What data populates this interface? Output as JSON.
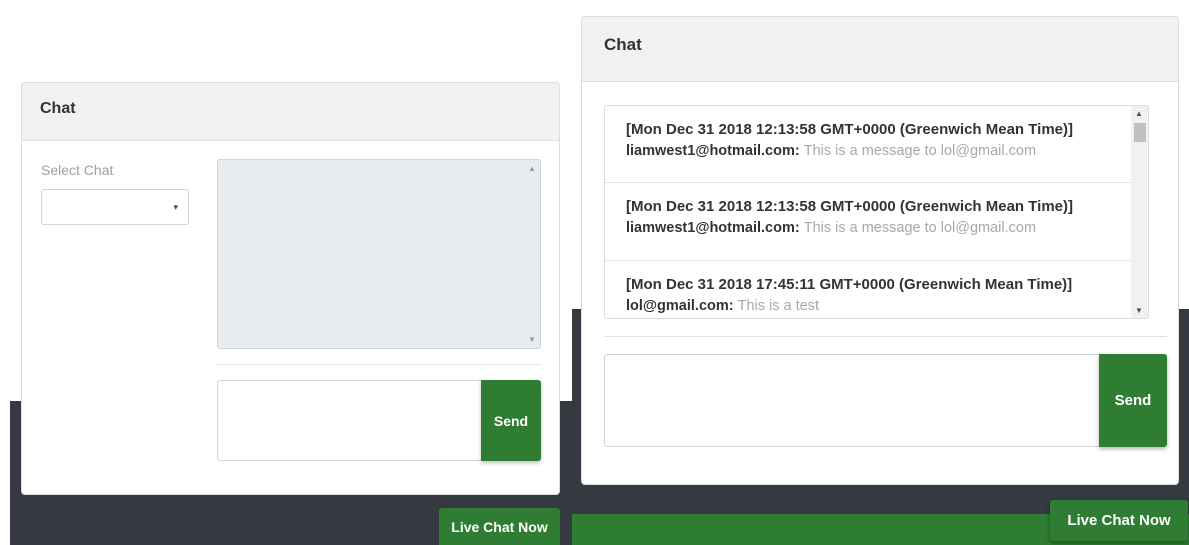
{
  "left": {
    "header_title": "Chat",
    "select_label": "Select Chat",
    "select_value": "",
    "send_label": "Send",
    "live_chat_label": "Live Chat Now"
  },
  "right": {
    "header_title": "Chat",
    "messages": [
      {
        "time": "[Mon Dec 31 2018 12:13:58 GMT+0000 (Greenwich Mean Time)]",
        "sender": "liamwest1@hotmail.com:",
        "text": "This is a message to lol@gmail.com"
      },
      {
        "time": "[Mon Dec 31 2018 12:13:58 GMT+0000 (Greenwich Mean Time)]",
        "sender": "liamwest1@hotmail.com:",
        "text": "This is a message to lol@gmail.com"
      },
      {
        "time": "[Mon Dec 31 2018 17:45:11 GMT+0000 (Greenwich Mean Time)]",
        "sender": "lol@gmail.com:",
        "text": "This is a test"
      }
    ],
    "send_label": "Send",
    "live_chat_label": "Live Chat Now"
  },
  "colors": {
    "accent_green": "#2e7d32",
    "dark_background": "#343a40",
    "card_header": "#f0f1f3",
    "disabled_area": "#e9ecef"
  },
  "icons": {
    "select_caret": "▾",
    "scroll_up": "▲",
    "scroll_down": "▼"
  }
}
